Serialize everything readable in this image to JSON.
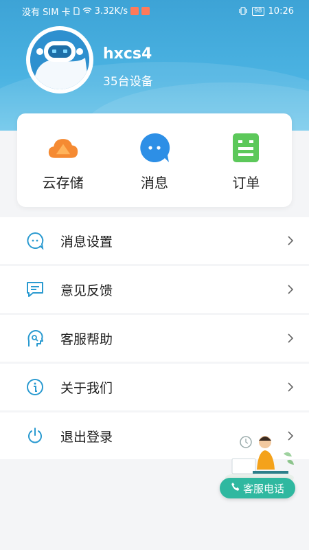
{
  "status_bar": {
    "carrier": "没有 SIM 卡",
    "speed": "3.32K/s",
    "battery": "98",
    "time": "10:26"
  },
  "profile": {
    "username": "hxcs4",
    "device_count": "35台设备",
    "avatar_icon": "robot-avatar-icon"
  },
  "quick_actions": [
    {
      "label": "云存储",
      "icon": "cloud-storage-icon",
      "color": "#f47b2a"
    },
    {
      "label": "消息",
      "icon": "message-bubble-icon",
      "color": "#2d8fe6"
    },
    {
      "label": "订单",
      "icon": "order-list-icon",
      "color": "#5cc85a"
    }
  ],
  "menu": [
    {
      "label": "消息设置",
      "icon": "chat-settings-icon"
    },
    {
      "label": "意见反馈",
      "icon": "feedback-icon"
    },
    {
      "label": "客服帮助",
      "icon": "customer-help-icon"
    },
    {
      "label": "关于我们",
      "icon": "info-icon"
    },
    {
      "label": "退出登录",
      "icon": "power-icon"
    }
  ],
  "service": {
    "button_label": "客服电话",
    "icon": "phone-icon"
  },
  "colors": {
    "header": "#3da3d6",
    "menu_icon": "#2a9ad0",
    "service_button": "#2fb8a0"
  }
}
